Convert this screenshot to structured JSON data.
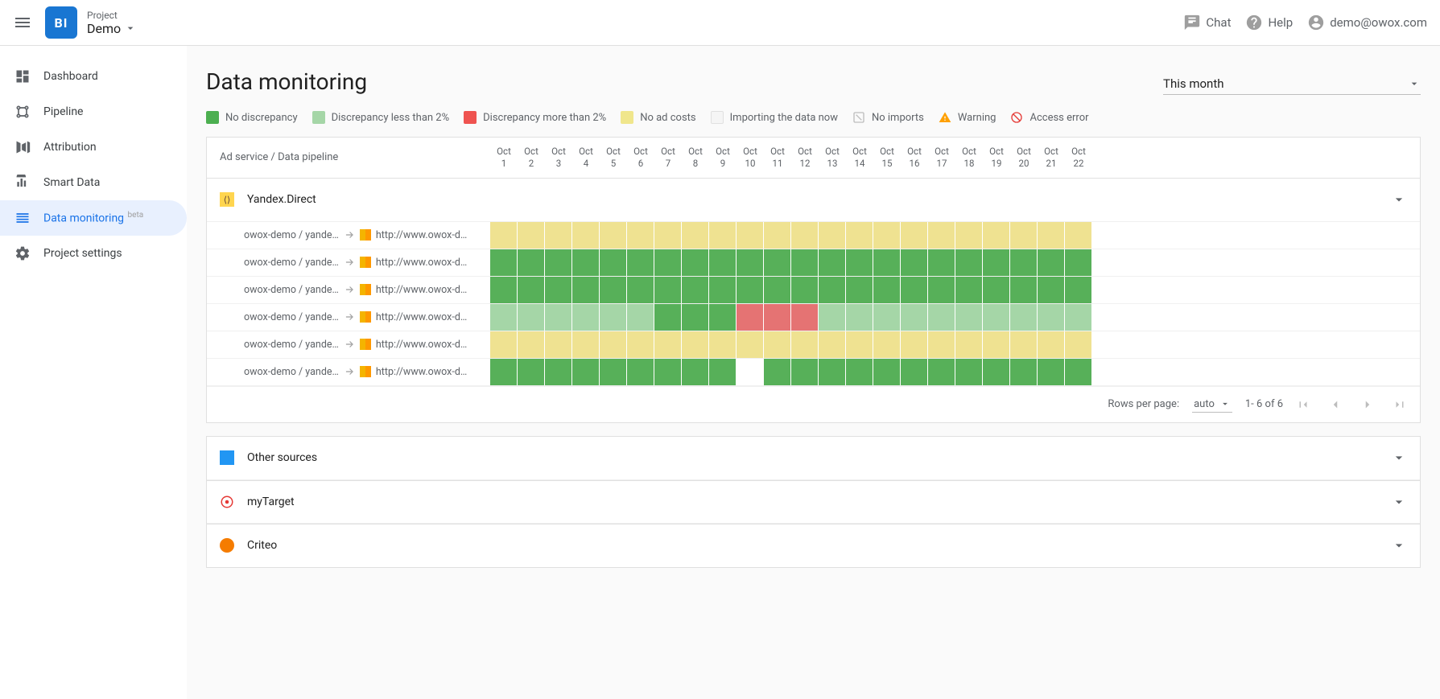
{
  "header": {
    "project_label": "Project",
    "project_name": "Demo",
    "chat": "Chat",
    "help": "Help",
    "user_email": "demo@owox.com",
    "logo_text": "BI"
  },
  "sidebar": {
    "items": [
      {
        "label": "Dashboard",
        "icon": "dashboard"
      },
      {
        "label": "Pipeline",
        "icon": "pipeline"
      },
      {
        "label": "Attribution",
        "icon": "attribution"
      },
      {
        "label": "Smart Data",
        "icon": "smartdata"
      },
      {
        "label": "Data monitoring",
        "icon": "monitoring",
        "active": true,
        "badge": "beta"
      },
      {
        "label": "Project settings",
        "icon": "settings"
      }
    ]
  },
  "page": {
    "title": "Data monitoring",
    "date_range": "This month"
  },
  "legend": [
    {
      "type": "swatch",
      "color": "green",
      "label": "No discrepancy"
    },
    {
      "type": "swatch",
      "color": "lightgreen",
      "label": "Discrepancy less than 2%"
    },
    {
      "type": "swatch",
      "color": "red",
      "label": "Discrepancy more than 2%"
    },
    {
      "type": "swatch",
      "color": "yellow",
      "label": "No ad costs"
    },
    {
      "type": "swatch",
      "color": "grey",
      "label": "Importing the data now"
    },
    {
      "type": "icon",
      "icon": "noimport",
      "label": "No imports"
    },
    {
      "type": "icon",
      "icon": "warning",
      "label": "Warning"
    },
    {
      "type": "icon",
      "icon": "accesserr",
      "label": "Access error"
    }
  ],
  "table": {
    "label_header": "Ad service / Data pipeline",
    "dates": [
      "Oct 1",
      "Oct 2",
      "Oct 3",
      "Oct 4",
      "Oct 5",
      "Oct 6",
      "Oct 7",
      "Oct 8",
      "Oct 9",
      "Oct 10",
      "Oct 11",
      "Oct 12",
      "Oct 13",
      "Oct 14",
      "Oct 15",
      "Oct 16",
      "Oct 17",
      "Oct 18",
      "Oct 19",
      "Oct 20",
      "Oct 21",
      "Oct 22"
    ],
    "sections": [
      {
        "name": "Yandex.Direct",
        "icon": "yandex",
        "expanded": true,
        "rows": [
          {
            "source": "owox-demo / yande…",
            "destination": "http://www.owox-d…",
            "cells": [
              "yellow",
              "yellow",
              "yellow",
              "yellow",
              "yellow",
              "yellow",
              "yellow",
              "yellow",
              "yellow",
              "yellow",
              "yellow",
              "yellow",
              "yellow",
              "yellow",
              "yellow",
              "yellow",
              "yellow",
              "yellow",
              "yellow",
              "yellow",
              "yellow",
              "yellow"
            ]
          },
          {
            "source": "owox-demo / yande…",
            "destination": "http://www.owox-d…",
            "cells": [
              "green",
              "green",
              "green",
              "green",
              "green",
              "green",
              "green",
              "green",
              "green",
              "green",
              "green",
              "green",
              "green",
              "green",
              "green",
              "green",
              "green",
              "green",
              "green",
              "green",
              "green",
              "green"
            ]
          },
          {
            "source": "owox-demo / yande…",
            "destination": "http://www.owox-d…",
            "cells": [
              "green",
              "green",
              "green",
              "green",
              "green",
              "green",
              "green",
              "green",
              "green",
              "green",
              "green",
              "green",
              "green",
              "green",
              "green",
              "green",
              "green",
              "green",
              "green",
              "green",
              "green",
              "green"
            ]
          },
          {
            "source": "owox-demo / yande…",
            "destination": "http://www.owox-d…",
            "cells": [
              "lightgreen",
              "lightgreen",
              "lightgreen",
              "lightgreen",
              "lightgreen",
              "lightgreen",
              "green",
              "green",
              "green",
              "red",
              "red",
              "red",
              "lightgreen",
              "lightgreen",
              "lightgreen",
              "lightgreen",
              "lightgreen",
              "lightgreen",
              "lightgreen",
              "lightgreen",
              "lightgreen",
              "lightgreen"
            ]
          },
          {
            "source": "owox-demo / yande…",
            "destination": "http://www.owox-d…",
            "cells": [
              "yellow",
              "yellow",
              "yellow",
              "yellow",
              "yellow",
              "yellow",
              "yellow",
              "yellow",
              "yellow",
              "yellow",
              "yellow",
              "yellow",
              "yellow",
              "yellow",
              "yellow",
              "yellow",
              "yellow",
              "yellow",
              "yellow",
              "yellow",
              "yellow",
              "yellow"
            ]
          },
          {
            "source": "owox-demo / yande…",
            "destination": "http://www.owox-d…",
            "cells": [
              "green",
              "green",
              "green",
              "green",
              "green",
              "green",
              "green",
              "green",
              "green",
              "empty",
              "green",
              "green",
              "green",
              "green",
              "green",
              "green",
              "green",
              "green",
              "green",
              "green",
              "green",
              "green"
            ]
          }
        ]
      },
      {
        "name": "Other sources",
        "icon": "other",
        "expanded": false
      },
      {
        "name": "myTarget",
        "icon": "mytarget",
        "expanded": false
      },
      {
        "name": "Criteo",
        "icon": "criteo",
        "expanded": false
      }
    ]
  },
  "pager": {
    "rows_label": "Rows per page:",
    "rows_value": "auto",
    "range_text": "1- 6  of 6"
  }
}
